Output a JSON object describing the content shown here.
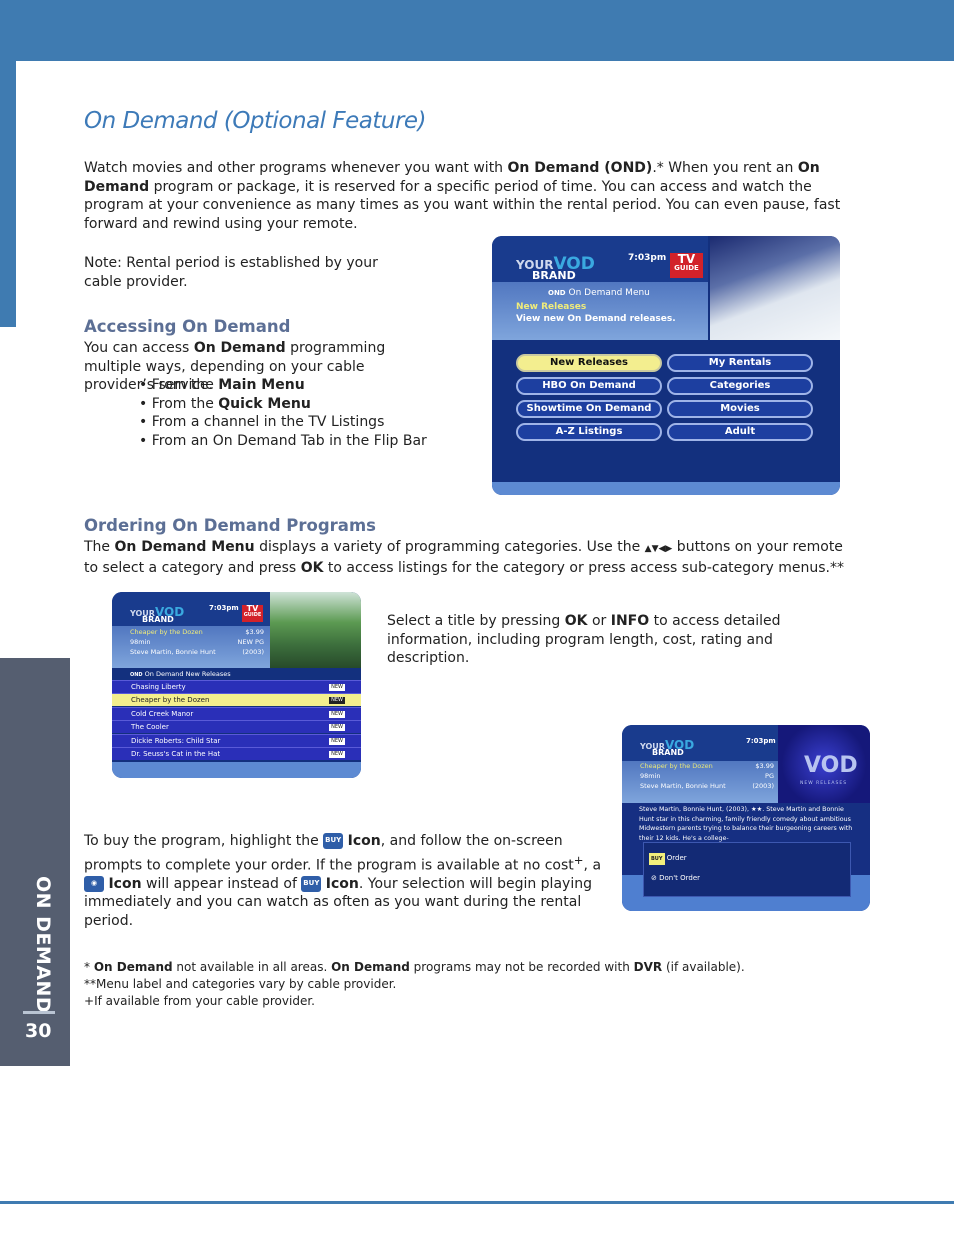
{
  "title": "On Demand  (Optional Feature)",
  "intro": {
    "p1a": "Watch movies and other programs whenever you want with ",
    "p1b": "On Demand (OND)",
    "p1c": ".* When you rent an ",
    "p1d": "On Demand",
    "p1e": " program or package, it is reserved for a specific period of time. You can access and watch the program at your convenience as many times as you want within the rental period. You can even pause, fast forward and rewind using your remote.",
    "note": "Note:  Rental period is established by your cable provider."
  },
  "accessing": {
    "heading": "Accessing On Demand",
    "a": "You can access ",
    "b": "On Demand",
    "c": " programming multiple ways, depending on your cable provider’s service.",
    "items": [
      {
        "pre": "From the ",
        "bold": "Main Menu",
        "post": ""
      },
      {
        "pre": "From the ",
        "bold": "Quick Menu",
        "post": ""
      },
      {
        "pre": "From a channel in the TV Listings",
        "bold": "",
        "post": ""
      },
      {
        "pre": "From an On Demand Tab in the Flip Bar",
        "bold": "",
        "post": ""
      }
    ]
  },
  "ordering": {
    "heading": "Ordering On Demand Programs",
    "a": "The ",
    "b": "On Demand Menu",
    "c": " displays a variety of programming categories. Use the ",
    "arrows": "▲▼◀▶",
    "d": " buttons on your remote to select a category and press ",
    "e": "OK",
    "f": " to access listings for the category or press access sub-category menus.**"
  },
  "select_text": {
    "a": "Select a title by pressing ",
    "b": "OK",
    "c": " or ",
    "d": "INFO",
    "e": " to access detailed information, including program length, cost, rating and description."
  },
  "buy_text": {
    "a": "To buy the program, highlight the ",
    "icon1": "BUY",
    "b": "Icon",
    "c": ", and follow the on-screen prompts to complete your order. If the program is available at no cost",
    "plus": "+",
    "d": ", a ",
    "icon2": "eye-icon",
    "e": "Icon",
    "f": " will appear instead of ",
    "icon3": "BUY",
    "g": "Icon",
    "h": ". Your selection will begin playing immediately and you can watch as often as you want during the rental period."
  },
  "footnotes": {
    "f1a": "* ",
    "f1b": "On Demand",
    "f1c": " not available in all areas. ",
    "f1d": "On Demand",
    "f1e": " programs may not be recorded with ",
    "f1f": "DVR",
    "f1g": " (if available).",
    "f2": "**Menu label and categories vary by cable provider.",
    "f3a": "+",
    "f3b": "If available from your cable provider."
  },
  "sidebar": {
    "section": "ON DEMAND",
    "page": "30"
  },
  "screen1": {
    "logo_your": "YOUR",
    "logo_vod": "VOD",
    "logo_brand": "BRAND",
    "time": "7:03pm",
    "tvguide_tv": "TV",
    "tvguide_guide": "GUIDE",
    "ond": "OND",
    "menu_title": "On Demand Menu",
    "highlight": "New Releases",
    "desc": "View new On Demand releases.",
    "buttons": [
      "New Releases",
      "My Rentals",
      "HBO On Demand",
      "Categories",
      "Showtime On Demand",
      "Movies",
      "A-Z Listings",
      "Adult"
    ],
    "selected": "New Releases"
  },
  "screen2": {
    "logo_your": "YOUR",
    "logo_vod": "VOD",
    "logo_brand": "BRAND",
    "time": "7:03pm",
    "tvguide_tv": "TV",
    "tvguide_guide": "GUIDE",
    "title": "Cheaper by the Dozen",
    "price": "$3.99",
    "length": "98min",
    "new": "NEW",
    "rating": "PG",
    "cast": "Steve Martin, Bonnie Hunt",
    "year": "(2003)",
    "ond": "OND",
    "list_title": "On Demand New Releases",
    "rows": [
      "Chasing Liberty",
      "Cheaper by the Dozen",
      "Cold Creek Manor",
      "The Cooler",
      "Dickie Roberts: Child Star",
      "Dr. Seuss's Cat in the Hat"
    ],
    "row_badge": "NEW",
    "selected": "Cheaper by the Dozen"
  },
  "screen3": {
    "logo_your": "YOUR",
    "logo_vod": "VOD",
    "logo_brand": "BRAND",
    "time": "7:03pm",
    "title": "Cheaper by the Dozen",
    "price": "$3.99",
    "length": "98min",
    "rating": "PG",
    "cast": "Steve Martin, Bonnie Hunt",
    "year": "(2003)",
    "promo_vod": "VOD",
    "promo_sub": "NEW RELEASES",
    "description": "Steve Martin, Bonnie Hunt, (2003), ★★. Steve Martin and Bonnie Hunt star in this charming, family friendly comedy about ambitious Midwestern parents trying to balance their burgeoning careers with their 12 kids. He's a college-",
    "buy": "BUY",
    "order": "Order",
    "dont_order": "Don't Order"
  }
}
